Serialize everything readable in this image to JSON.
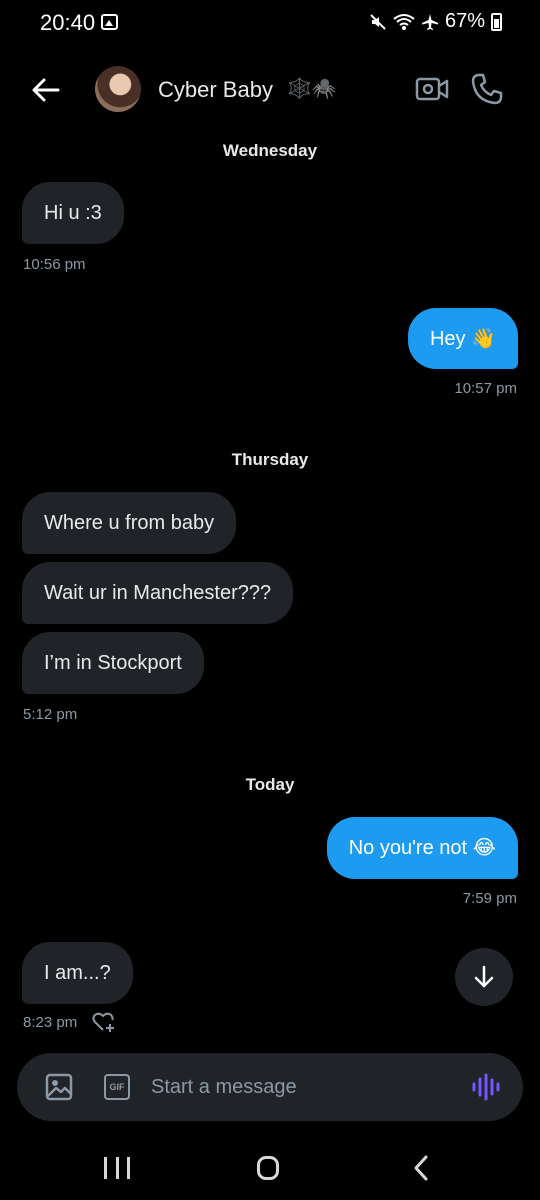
{
  "status": {
    "time": "20:40",
    "battery": "67%"
  },
  "header": {
    "name": "Cyber Baby",
    "name_emoji": "🕸️🕷️"
  },
  "dates": {
    "wednesday": "Wednesday",
    "thursday": "Thursday",
    "today": "Today"
  },
  "messages": {
    "m1": {
      "text": "Hi u :3",
      "time": "10:56 pm"
    },
    "m2": {
      "text": "Hey 👋",
      "time": "10:57 pm"
    },
    "m3": {
      "text": "Where u from baby"
    },
    "m4": {
      "text": "Wait ur in Manchester???"
    },
    "m5": {
      "text": "I’m in Stockport",
      "time": "5:12 pm"
    },
    "m6": {
      "text": "No you're not 😂",
      "time": "7:59 pm"
    },
    "m7": {
      "text": "I am...?",
      "time": "8:23 pm"
    }
  },
  "composer": {
    "placeholder": "Start a message",
    "gif_label": "GIF"
  },
  "colors": {
    "sent_bubble": "#1d9bf0",
    "received_bubble": "#202327",
    "voice_accent": "#7856ff"
  }
}
